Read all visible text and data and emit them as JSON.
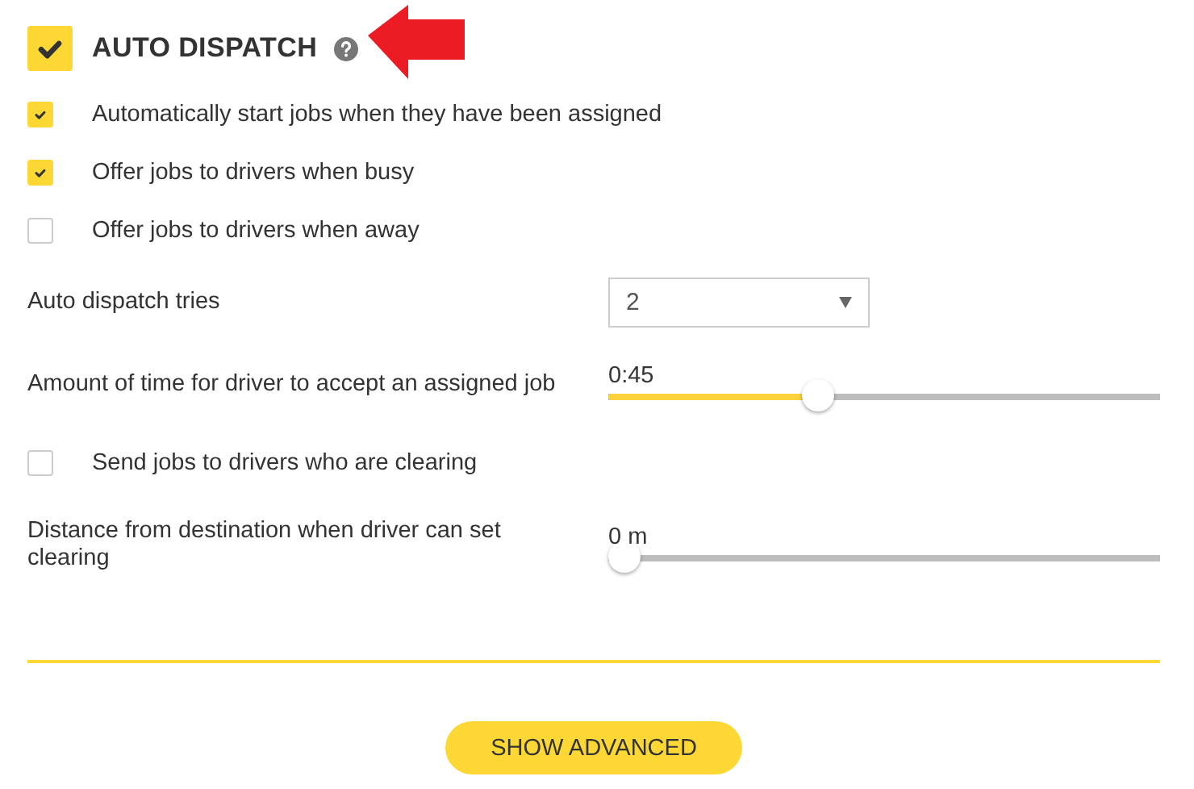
{
  "header": {
    "title": "AUTO DISPATCH",
    "checked": true
  },
  "settings": [
    {
      "kind": "checkbox",
      "label": "Automatically start jobs when they have been assigned",
      "checked": true
    },
    {
      "kind": "checkbox",
      "label": "Offer jobs to drivers when busy",
      "checked": true
    },
    {
      "kind": "checkbox",
      "label": "Offer jobs to drivers when away",
      "checked": false
    },
    {
      "kind": "select",
      "label": "Auto dispatch tries",
      "value": "2"
    },
    {
      "kind": "slider",
      "label": "Amount of time for driver to accept an assigned job",
      "reading": "0:45",
      "level": 0.38
    },
    {
      "kind": "checkbox",
      "label": "Send jobs to drivers who are clearing",
      "checked": false
    },
    {
      "kind": "slider",
      "label": "Distance from destination when driver can set clearing",
      "reading": "0 m",
      "level": 0
    }
  ],
  "button": "SHOW ADVANCED"
}
